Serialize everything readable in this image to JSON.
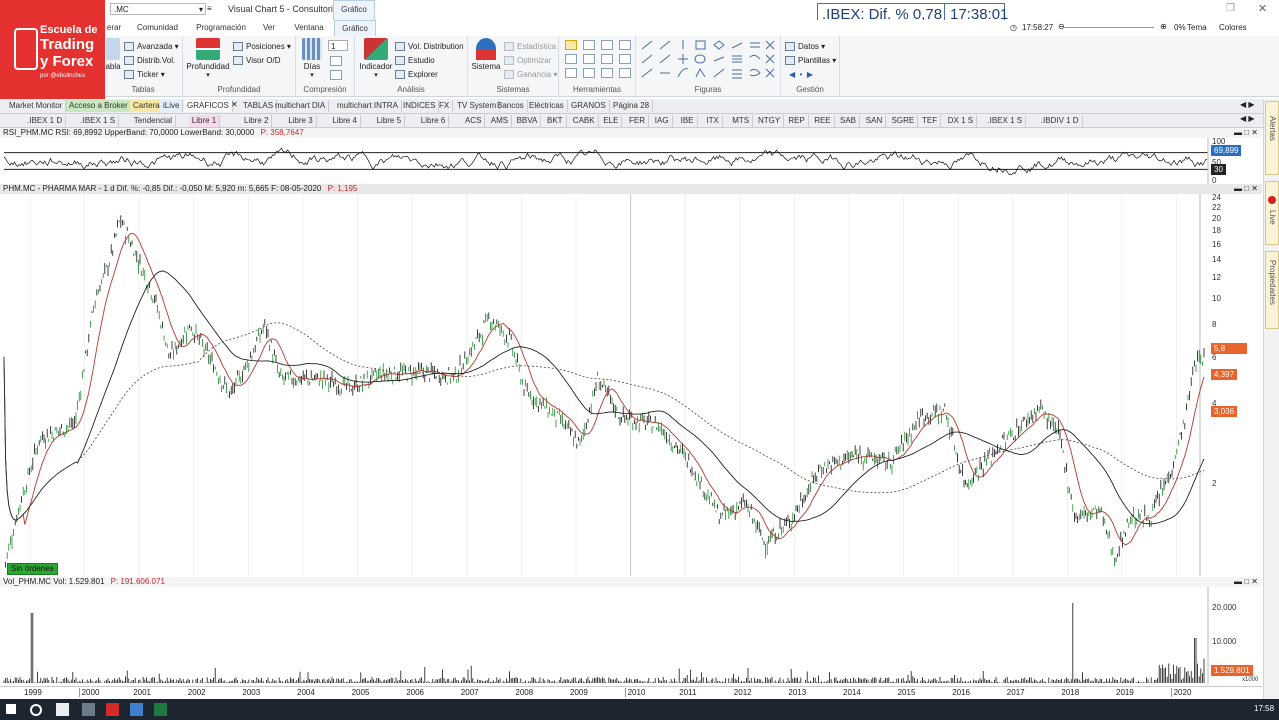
{
  "app": {
    "window_title": "Visual Chart 5 - Consultorio",
    "context_tab": "Gráfico",
    "symbol_box": ".MC",
    "clock_top": "17:58:27",
    "zoom": "0%",
    "tema": "Tema",
    "colores": "Colores"
  },
  "ticker": {
    "text": ".IBEX: Dif. % 0,78",
    "time": "17:38:01"
  },
  "logo": {
    "line1": "Escuela de",
    "line2": "Trading",
    "line3": "y Forex",
    "line4": "por @ebolinches"
  },
  "ribbon_tabs": [
    "erar",
    "Comunidad",
    "Programación",
    "Ver",
    "Ventana",
    "Gráfico"
  ],
  "ribbon": {
    "tablas": {
      "label": "Tablas",
      "big": "abla",
      "items": [
        "Avanzada",
        "Distrib.Vol.",
        "Ticker"
      ]
    },
    "profundidad": {
      "label": "Profundidad",
      "big": "Profundidad",
      "items": [
        "Posiciones",
        "Visor O/D"
      ]
    },
    "compresion": {
      "label": "Compresión",
      "big": "Días",
      "value": "1"
    },
    "analisis": {
      "label": "Análisis",
      "big": "Indicador",
      "items": [
        "Vol. Distribution",
        "Estudio",
        "Explorer"
      ]
    },
    "sistemas": {
      "label": "Sistemas",
      "big": "Sistema",
      "items": [
        "Estadística",
        "Optimizar",
        "Ganancia"
      ]
    },
    "herramientas": {
      "label": "Herramientas"
    },
    "figuras": {
      "label": "Figuras"
    },
    "gestion": {
      "label": "Gestión",
      "items": [
        "Datos",
        "Plantillas"
      ]
    }
  },
  "sheet_tabs": [
    "Market Monitor",
    "Acceso a Broker",
    "Cartera",
    "iLive",
    "GRAFICOS",
    "TABLAS",
    "multichart DIA",
    "multichart INTRA",
    "INDICES",
    "FX",
    "TV System",
    "Bancos",
    "Eléctricas",
    "GRANOS",
    "Página 28"
  ],
  "symbol_tabs": [
    ".IBEX 1 D",
    ".IBEX 1 S",
    "Tendencial",
    "Libre 1",
    "Libre 2",
    "Libre 3",
    "Libre 4",
    "Libre 5",
    "Libre 6",
    "ACS",
    "AMS",
    "BBVA",
    "BKT",
    "CABK",
    "ELE",
    "FER",
    "IAG",
    "IBE",
    "ITX",
    "MTS",
    "NTGY",
    "REP",
    "REE",
    "SAB",
    "SAN",
    "SGRE",
    "TEF",
    "DX 1 S",
    ".IBEX 1 S",
    ".IBDIV 1 D"
  ],
  "rsi_panel": {
    "header": "RSI_PHM.MC  RSI: 69,8992  UpperBand: 70,0000  LowerBand: 30,0000",
    "header_p": "P: 358,7647",
    "value_tag": "69,899",
    "band_tag": "30",
    "axis": [
      "100",
      "50",
      "0"
    ]
  },
  "price_panel": {
    "header": "PHM.MC - PHARMA MAR - 1 d  Dif. %: -0,85  Dif.: -0,050  M: 5,920  m: 5,665  F: 08-05-2020",
    "header_p": "P: 1,195",
    "axis": [
      "24",
      "22",
      "20",
      "18",
      "16",
      "14",
      "12",
      "10",
      "8",
      "6",
      "4",
      "2"
    ],
    "tags": [
      "5,8",
      "4,397",
      "3,036"
    ],
    "status_badge": "Sin órdenes"
  },
  "volume_panel": {
    "header": "Vol_PHM.MC  Vol: 1.529.801",
    "header_p": "P: 191.606.071",
    "axis": [
      "20.000",
      "10.000"
    ],
    "value_tag": "1.529.801",
    "unit": "x1000"
  },
  "time_axis": [
    "1999",
    "2000",
    "2001",
    "2002",
    "2003",
    "2004",
    "2005",
    "2006",
    "2007",
    "2008",
    "2009",
    "2010",
    "2011",
    "2012",
    "2013",
    "2014",
    "2015",
    "2016",
    "2017",
    "2018",
    "2019",
    "2020"
  ],
  "right_sidebar": [
    "Alertas",
    "Live",
    "Propiedades"
  ],
  "taskbar": {
    "time": "17:58"
  },
  "colors": {
    "accent": "#1f5fa8",
    "logo": "#e5312f",
    "up_candle": "#1a8a2a",
    "down_candle": "#111111",
    "price_tag": "#e8642c",
    "badge": "#2aa832"
  }
}
